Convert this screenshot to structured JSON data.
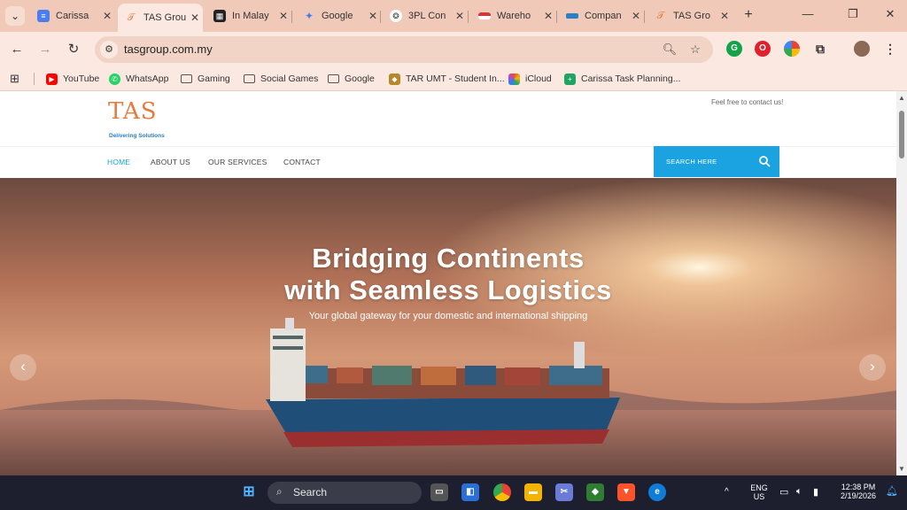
{
  "browser": {
    "tabs": [
      {
        "title": "Carissa",
        "favicon": "docs-icon",
        "color": "#4a7df0",
        "active": false
      },
      {
        "title": "TAS Grou",
        "favicon": "tas-icon",
        "color": "#e87a3e",
        "active": true
      },
      {
        "title": "In Malay",
        "favicon": "grid-icon",
        "color": "#222222",
        "active": false
      },
      {
        "title": "Google",
        "favicon": "gemini-icon",
        "color": "#4a7df0",
        "active": false
      },
      {
        "title": "3PL Con",
        "favicon": "chatgpt-icon",
        "color": "#444444",
        "active": false
      },
      {
        "title": "Wareho",
        "favicon": "flag-icon",
        "color": "#d0383b",
        "active": false
      },
      {
        "title": "Compan",
        "favicon": "company-icon",
        "color": "#2a7fc9",
        "active": false
      },
      {
        "title": "TAS Gro",
        "favicon": "tas-icon",
        "color": "#e87a3e",
        "active": false
      }
    ],
    "url": "tasgroup.com.my",
    "bookmarks": [
      {
        "label": "YouTube",
        "icon": "youtube-icon",
        "color": "#ff0000"
      },
      {
        "label": "WhatsApp",
        "icon": "whatsapp-icon",
        "color": "#25d366"
      },
      {
        "label": "Gaming",
        "icon": "folder-icon"
      },
      {
        "label": "Social Games",
        "icon": "folder-icon"
      },
      {
        "label": "Google",
        "icon": "folder-icon"
      },
      {
        "label": "TAR UMT - Student In...",
        "icon": "tarumt-icon",
        "color": "#b8862b"
      },
      {
        "label": "iCloud",
        "icon": "icloud-icon",
        "color": "#7a4fd1"
      },
      {
        "label": "Carissa Task Planning...",
        "icon": "sheets-icon",
        "color": "#1fa463"
      }
    ]
  },
  "site": {
    "logo_text": "TAS",
    "logo_tagline": "Delivering Solutions",
    "contact_note": "Feel free to contact us!",
    "nav": [
      {
        "label": "HOME",
        "active": true
      },
      {
        "label": "ABOUT US",
        "active": false
      },
      {
        "label": "OUR SERVICES",
        "active": false
      },
      {
        "label": "CONTACT",
        "active": false
      }
    ],
    "search_placeholder": "SEARCH HERE",
    "accent": "#1aa3e0",
    "hero": {
      "title_line1": "Bridging Continents",
      "title_line2": "with Seamless Logistics",
      "subtitle": "Your global gateway for your domestic and international shipping"
    }
  },
  "taskbar": {
    "search_label": "Search",
    "lang_line1": "ENG",
    "lang_line2": "US",
    "time": "12:38 PM",
    "date": "2/19/2026"
  }
}
